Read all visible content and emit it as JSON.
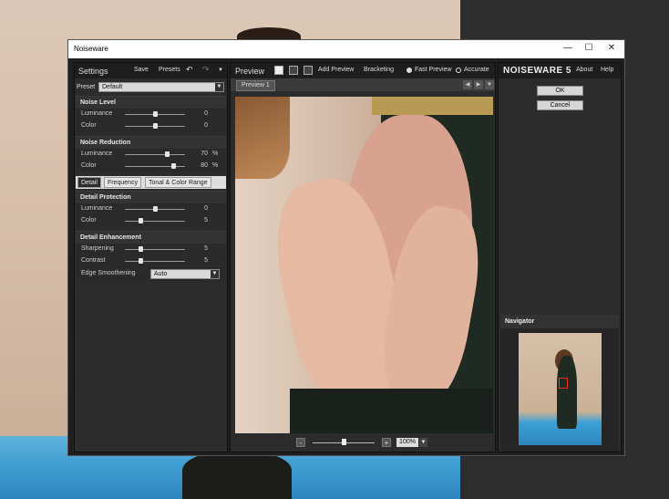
{
  "window": {
    "title": "Noiseware",
    "minimize": "—",
    "maximize": "☐",
    "close": "✕"
  },
  "settings": {
    "title": "Settings",
    "save": "Save",
    "presets": "Presets",
    "undo_icon": "undo-icon",
    "redo_icon": "redo-icon",
    "preset_label": "Preset",
    "preset_value": "Default",
    "noise_level": {
      "title": "Noise Level",
      "rows": [
        {
          "label": "Luminance",
          "value": "0",
          "unit": "",
          "level": 0.5
        },
        {
          "label": "Color",
          "value": "0",
          "unit": "",
          "level": 0.5
        }
      ]
    },
    "noise_reduction": {
      "title": "Noise Reduction",
      "rows": [
        {
          "label": "Luminance",
          "value": "70",
          "unit": "%",
          "level": 0.7
        },
        {
          "label": "Color",
          "value": "80",
          "unit": "%",
          "level": 0.8
        }
      ]
    },
    "tabs": [
      "Detail",
      "Frequency",
      "Tonal & Color Range"
    ],
    "detail_protection": {
      "title": "Detail Protection",
      "rows": [
        {
          "label": "Luminance",
          "value": "0",
          "unit": "",
          "level": 0.5
        },
        {
          "label": "Color",
          "value": "5",
          "unit": "",
          "level": 0.25
        }
      ]
    },
    "detail_enhancement": {
      "title": "Detail Enhancement",
      "rows": [
        {
          "label": "Sharpening",
          "value": "5",
          "unit": "",
          "level": 0.25
        },
        {
          "label": "Contrast",
          "value": "5",
          "unit": "",
          "level": 0.25
        }
      ],
      "edge_label": "Edge Smoothening",
      "edge_value": "Auto"
    }
  },
  "preview": {
    "title": "Preview",
    "add_preview": "Add Preview",
    "bracketing": "Bracketing",
    "fast_preview": "Fast Preview",
    "accurate": "Accurate",
    "tab": "Preview 1",
    "zoom_out": "-",
    "zoom_in": "+",
    "zoom_value": "100%",
    "zoom_level": 0.5
  },
  "right": {
    "logo": "NOISEWARE 5",
    "about": "About",
    "help": "Help",
    "ok": "OK",
    "cancel": "Cancel",
    "navigator": "Navigator"
  }
}
